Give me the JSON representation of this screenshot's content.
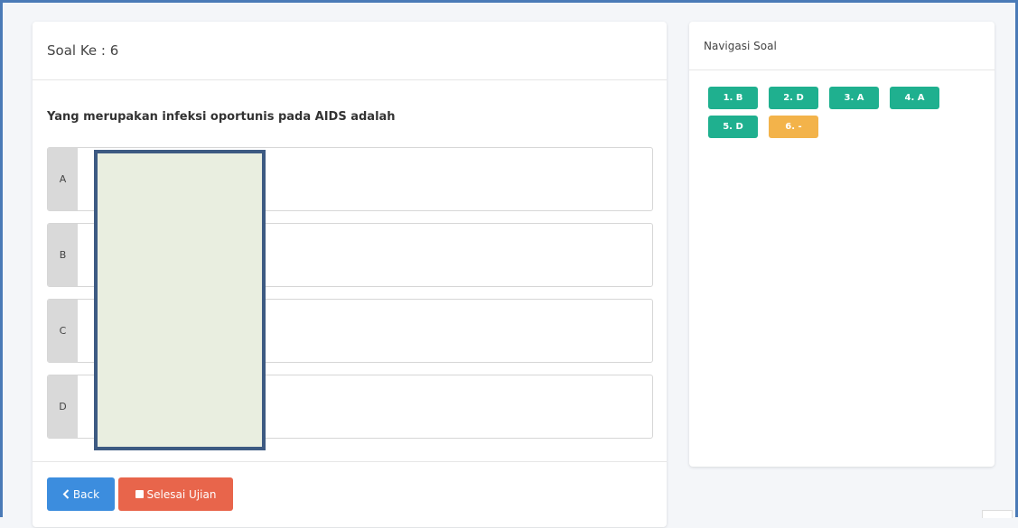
{
  "main": {
    "header": "Soal Ke : 6",
    "question": "Yang merupakan infeksi oportunis pada AIDS adalah",
    "options": [
      {
        "letter": "A",
        "text": ""
      },
      {
        "letter": "B",
        "text": ""
      },
      {
        "letter": "C",
        "text": ""
      },
      {
        "letter": "D",
        "text": ""
      }
    ],
    "buttons": {
      "back_label": "Back",
      "back_icon": "chevron-left-icon",
      "finish_label": "Selesai Ujian",
      "finish_icon": "stop-icon"
    }
  },
  "nav": {
    "title": "Navigasi Soal",
    "items": [
      {
        "label": "1. B",
        "status": "answered"
      },
      {
        "label": "2. D",
        "status": "answered"
      },
      {
        "label": "3. A",
        "status": "answered"
      },
      {
        "label": "4. A",
        "status": "answered"
      },
      {
        "label": "5. D",
        "status": "answered"
      },
      {
        "label": "6. -",
        "status": "current"
      }
    ]
  },
  "colors": {
    "answered": "#1fb08f",
    "current": "#f3b34a",
    "back_button": "#3c8dde",
    "finish_button": "#e8654b",
    "redaction_fill": "#e9eee0",
    "redaction_border": "#3d5a82"
  }
}
